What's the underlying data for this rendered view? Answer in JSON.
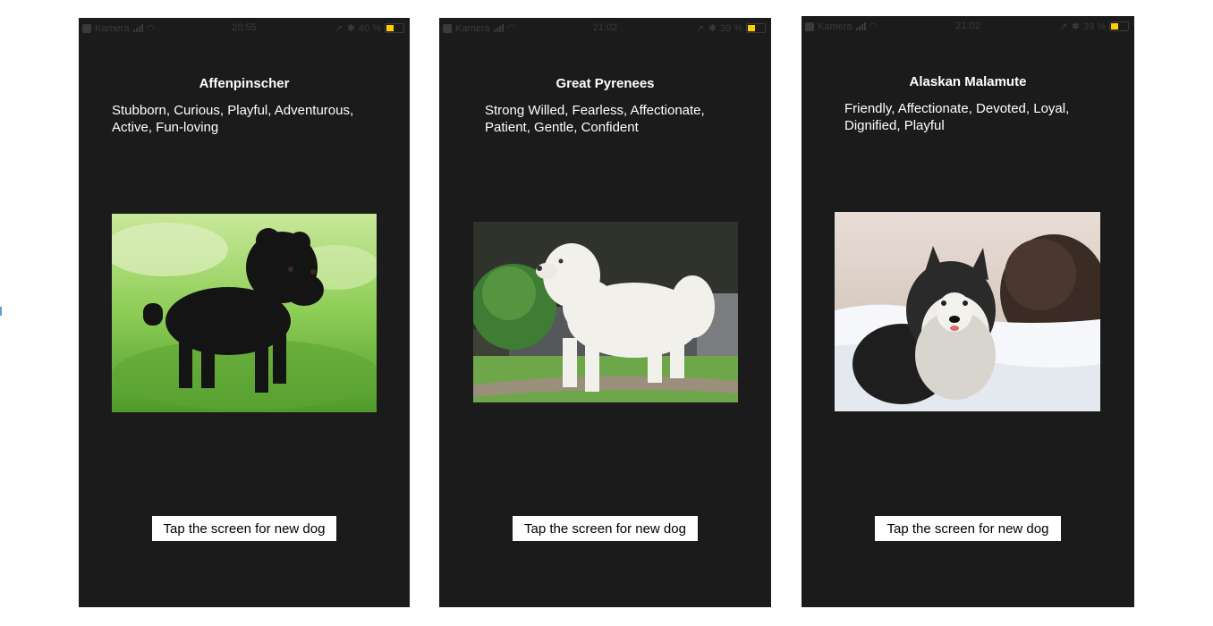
{
  "screens": [
    {
      "status": {
        "carrier": "Kamera",
        "time": "20:55",
        "battery": "40 %",
        "battery_level": 0.4
      },
      "breed": "Affenpinscher",
      "traits_line1": "Stubborn, Curious, Playful, Adventurous,",
      "traits_line2": "Active, Fun-loving",
      "button_label": "Tap the screen for new dog"
    },
    {
      "status": {
        "carrier": "Kamera",
        "time": "21:02",
        "battery": "39 %",
        "battery_level": 0.39
      },
      "breed": "Great Pyrenees",
      "traits_line1": "Strong Willed, Fearless, Affectionate,",
      "traits_line2": "Patient, Gentle, Confident",
      "button_label": "Tap the screen for new dog"
    },
    {
      "status": {
        "carrier": "Kamera",
        "time": "21:02",
        "battery": "39 %",
        "battery_level": 0.39
      },
      "breed": "Alaskan Malamute",
      "traits_line1": "Friendly, Affectionate, Devoted, Loyal,",
      "traits_line2": "Dignified, Playful",
      "button_label": "Tap the screen for new dog"
    }
  ]
}
